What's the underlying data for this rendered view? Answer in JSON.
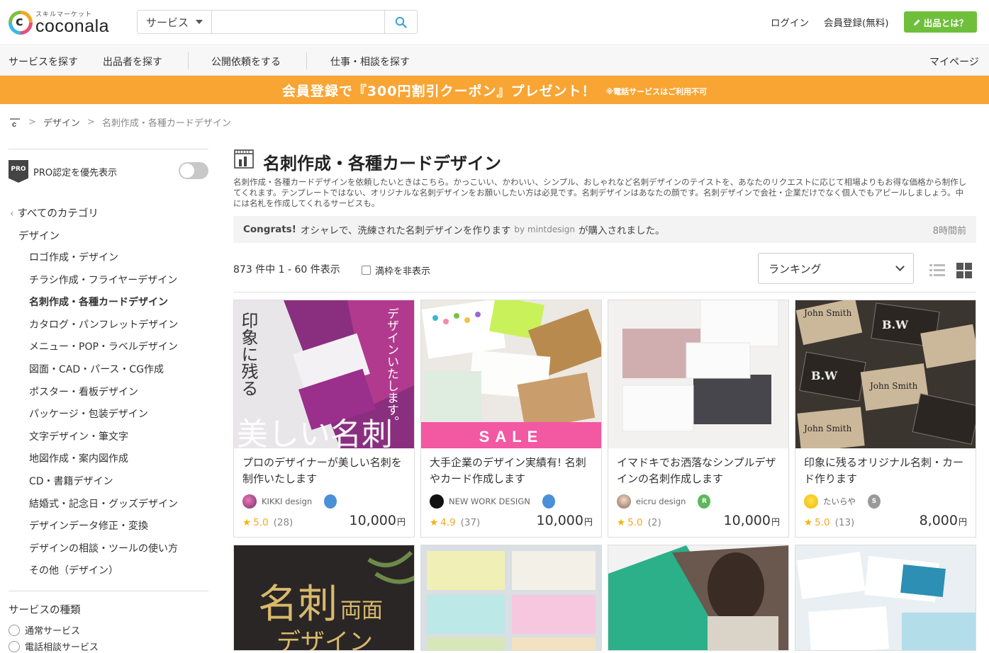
{
  "header": {
    "logo_sub": "スキルマーケット",
    "logo_text": "coconala",
    "search_category": "サービス",
    "search_placeholder": "",
    "login": "ログイン",
    "register": "会員登録(無料)",
    "sell_button": "出品とは？"
  },
  "nav": {
    "items": [
      "サービスを探す",
      "出品者を探す",
      "公開依頼をする",
      "仕事・相談を探す"
    ],
    "mypage": "マイページ"
  },
  "banner": {
    "main": "会員登録で『300円割引クーポン』プレゼント！",
    "note": "※電話サービスはご利用不可"
  },
  "breadcrumb": {
    "level1": "デザイン",
    "current": "名刺作成・各種カードデザイン"
  },
  "sidebar": {
    "pro_label": "PRO認定を優先表示",
    "pro_badge": "PRO",
    "all_categories": "すべてのカテゴリ",
    "design": "デザイン",
    "categories": [
      "ロゴ作成・デザイン",
      "チラシ作成・フライヤーデザイン",
      "名刺作成・各種カードデザイン",
      "カタログ・パンフレットデザイン",
      "メニュー・POP・ラベルデザイン",
      "図面・CAD・パース・CG作成",
      "ポスター・看板デザイン",
      "パッケージ・包装デザイン",
      "文字デザイン・筆文字",
      "地図作成・案内図作成",
      "CD・書籍デザイン",
      "結婚式・記念日・グッズデザイン",
      "デザインデータ修正・変換",
      "デザインの相談・ツールの使い方",
      "その他（デザイン）"
    ],
    "service_type_title": "サービスの種類",
    "service_types": [
      "通常サービス",
      "電話相談サービス"
    ]
  },
  "main": {
    "title": "名刺作成・各種カードデザイン",
    "description": "名刺作成・各種カードデザインを依頼したいときはこちら。かっこいい、かわいい、シンプル、おしゃれなど名刺デザインのテイストを、あなたのリクエストに応じて相場よりもお得な価格から制作してくれます。テンプレートではない、オリジナルな名刺デザインをお願いしたい方は必見です。名刺デザインはあなたの顔です。名刺デザインで会社・企業だけでなく個人でもアピールしましょう。中には名札を作成してくれるサービスも。",
    "congrats": {
      "label": "Congrats!",
      "service": "オシャレで、洗練された名刺デザインを作ります",
      "by": "by mintdesign",
      "suffix": "が購入されました。",
      "ago": "8時間前"
    },
    "count": "873 件中 1 - 60 件表示",
    "hide_full": "満枠を非表示",
    "sort": "ランキング"
  },
  "cards": [
    {
      "title": "プロのデザイナーが美しい名刺を制作いたします",
      "seller": "KIKKI design",
      "rating": "5.0",
      "reviews": "(28)",
      "price": "10,000",
      "currency": "円",
      "rank_color": "#4a90d9",
      "rank_letter": ""
    },
    {
      "title": "大手企業のデザイン実績有! 名刺やカード作成します",
      "seller": "NEW WORK DESIGN",
      "rating": "4.9",
      "reviews": "(37)",
      "price": "10,000",
      "currency": "円",
      "rank_color": "#4a90d9",
      "rank_letter": ""
    },
    {
      "title": "イマドキでお洒落なシンプルデザインの名刺作成します",
      "seller": "eicru design",
      "rating": "5.0",
      "reviews": "(2)",
      "price": "10,000",
      "currency": "円",
      "rank_color": "#5cb85c",
      "rank_letter": "R"
    },
    {
      "title": "印象に残るオリジナル名刺・カード作ります",
      "seller": "たいらや",
      "rating": "5.0",
      "reviews": "(13)",
      "price": "8,000",
      "currency": "円",
      "rank_color": "#999999",
      "rank_letter": "S"
    }
  ],
  "card_image_text": {
    "c1_left": "印象に残る",
    "c1_right": "デザインいたします。",
    "c1_big": "美しい名刺",
    "c2_sale": "SALE",
    "c4_name": "John Smith",
    "c4_logo": "B.W",
    "r2_c1_big": "名刺",
    "r2_c1_side": "両面",
    "r2_c1_sub": "デザイン"
  }
}
